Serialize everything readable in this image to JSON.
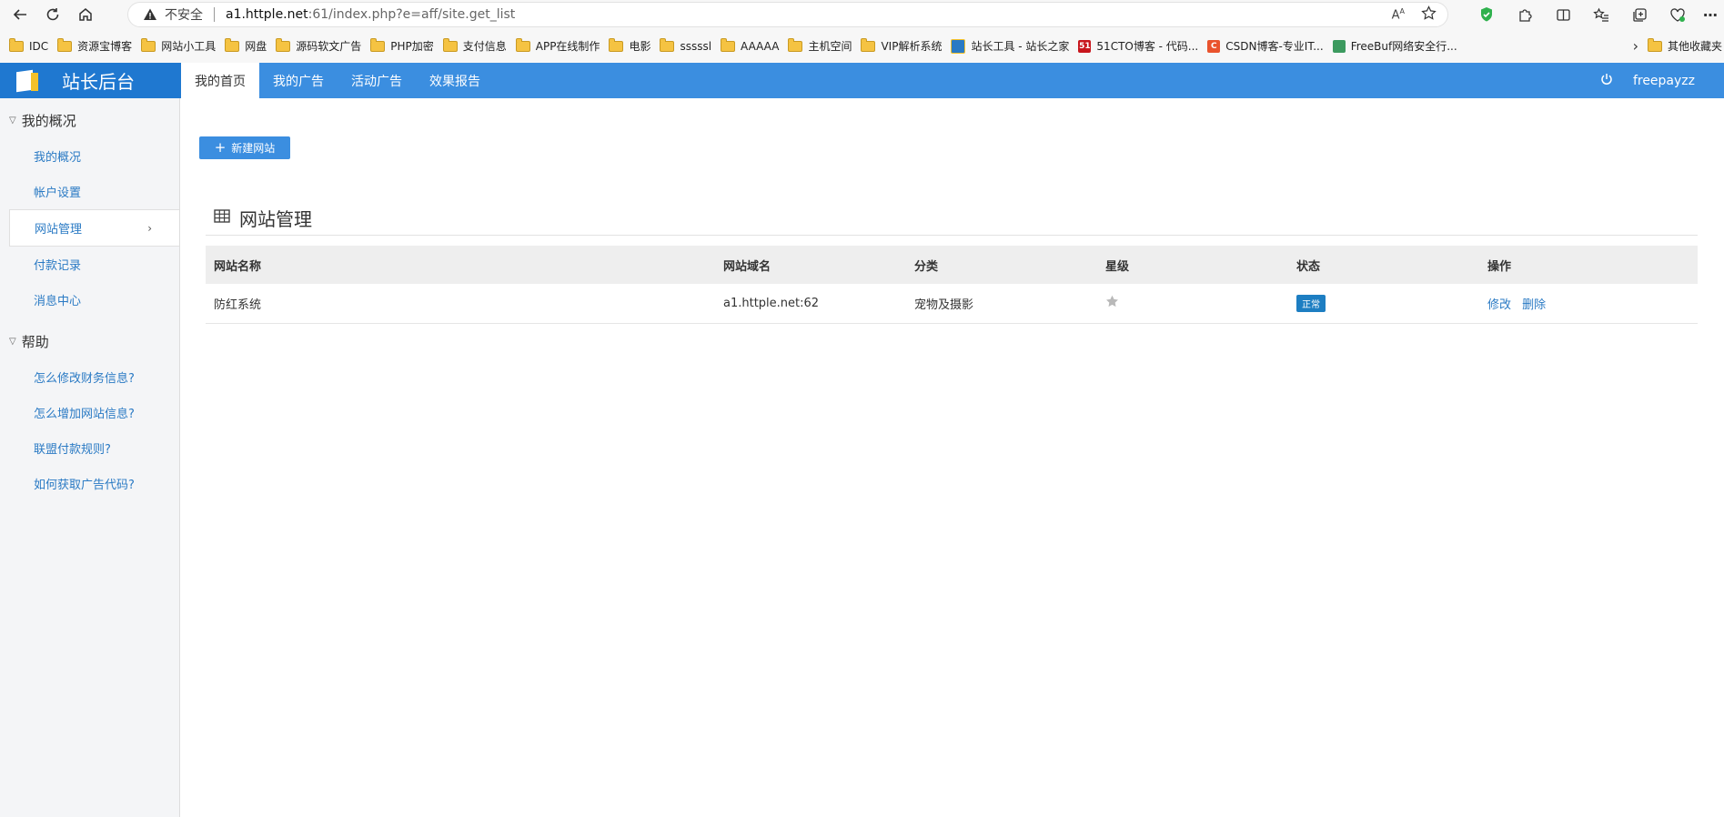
{
  "browser": {
    "insecure_label": "不安全",
    "url_host": "a1.httple.net",
    "url_path": ":61/index.php?e=aff/site.get_list",
    "reader_label": "Aᴬ"
  },
  "bookmarks": [
    {
      "label": "IDC",
      "type": "folder"
    },
    {
      "label": "资源宝博客",
      "type": "folder"
    },
    {
      "label": "网站小工具",
      "type": "folder"
    },
    {
      "label": "网盘",
      "type": "folder"
    },
    {
      "label": "源码软文广告",
      "type": "folder"
    },
    {
      "label": "PHP加密",
      "type": "folder"
    },
    {
      "label": "支付信息",
      "type": "folder"
    },
    {
      "label": "APP在线制作",
      "type": "folder"
    },
    {
      "label": "电影",
      "type": "folder"
    },
    {
      "label": "sssssl",
      "type": "folder"
    },
    {
      "label": "AAAAA",
      "type": "folder"
    },
    {
      "label": "主机空间",
      "type": "folder"
    },
    {
      "label": "VIP解析系统",
      "type": "folder"
    },
    {
      "label": "站长工具 - 站长之家",
      "type": "site",
      "color": "#2a7ac4",
      "glyph": ""
    },
    {
      "label": "51CTO博客 - 代码...",
      "type": "site",
      "color": "#c8161d",
      "glyph": "51"
    },
    {
      "label": "CSDN博客-专业IT...",
      "type": "site",
      "color": "#e9532d",
      "glyph": "C"
    },
    {
      "label": "FreeBuf网络安全行...",
      "type": "site",
      "color": "#3c9a5f",
      "glyph": ""
    }
  ],
  "bookmarks_more": "其他收藏夹",
  "header": {
    "logo_title": "站长后台",
    "tabs": [
      "我的首页",
      "我的广告",
      "活动广告",
      "效果报告"
    ],
    "active_tab": 0,
    "username": "freepayzz"
  },
  "sidebar": {
    "group1": "我的概况",
    "group1_items": [
      "我的概况",
      "帐户设置",
      "网站管理",
      "付款记录",
      "消息中心"
    ],
    "active_item": 2,
    "group2": "帮助",
    "group2_items": [
      "怎么修改财务信息?",
      "怎么增加网站信息?",
      "联盟付款规则?",
      "如何获取广告代码?"
    ]
  },
  "main": {
    "new_button": "新建网站",
    "section_title": "网站管理",
    "table": {
      "headers": [
        "网站名称",
        "网站域名",
        "分类",
        "星级",
        "状态",
        "操作"
      ],
      "rows": [
        {
          "name": "防红系统",
          "domain": "a1.httple.net:62",
          "category": "宠物及摄影",
          "stars": 1,
          "status": "正常",
          "actions": [
            "修改",
            "删除"
          ]
        }
      ]
    }
  },
  "colors": {
    "accent": "#3b8ee0",
    "logo_bg": "#1f78d0",
    "link": "#2a7ac4",
    "badge": "#1d7ec2"
  }
}
